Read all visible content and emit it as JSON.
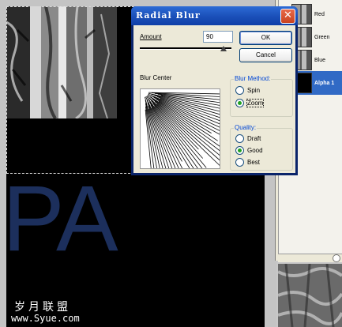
{
  "dialog": {
    "title": "Radial Blur",
    "close_glyph": "✕",
    "amount_label": "Amount",
    "amount_value": "90",
    "amount_slider_fraction": 0.9,
    "ok_label": "OK",
    "cancel_label": "Cancel",
    "blur_center_label": "Blur Center",
    "blur_method": {
      "label": "Blur Method:",
      "options": [
        {
          "label": "Spin",
          "selected": false
        },
        {
          "label": "Zoom",
          "selected": true
        }
      ]
    },
    "quality": {
      "label": "Quality:",
      "options": [
        {
          "label": "Draft",
          "selected": false
        },
        {
          "label": "Good",
          "selected": true
        },
        {
          "label": "Best",
          "selected": false
        }
      ]
    }
  },
  "channels": [
    {
      "label": "Red",
      "selected": false
    },
    {
      "label": "Green",
      "selected": false
    },
    {
      "label": "Blue",
      "selected": false
    },
    {
      "label": "Alpha 1",
      "selected": true
    }
  ],
  "canvas": {
    "big_text": "PA",
    "watermark_cn": "岁月联盟",
    "watermark_url": "www.Syue.com"
  },
  "colors": {
    "pa_text": "#1c2f5c",
    "selected_channel": "#316ac5",
    "titlebar": "#1a4fb8"
  }
}
